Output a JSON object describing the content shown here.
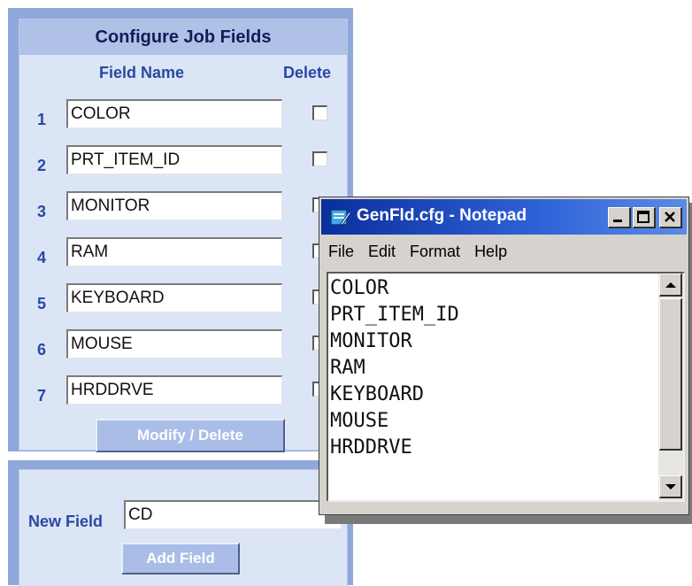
{
  "job_fields": {
    "title": "Configure Job Fields",
    "column_field_name": "Field Name",
    "column_delete": "Delete",
    "rows": [
      {
        "number": "1",
        "value": "COLOR"
      },
      {
        "number": "2",
        "value": "PRT_ITEM_ID"
      },
      {
        "number": "3",
        "value": "MONITOR"
      },
      {
        "number": "4",
        "value": "RAM"
      },
      {
        "number": "5",
        "value": "KEYBOARD"
      },
      {
        "number": "6",
        "value": "MOUSE"
      },
      {
        "number": "7",
        "value": "HRDDRVE"
      }
    ],
    "modify_button": "Modify / Delete"
  },
  "new_field": {
    "label": "New Field",
    "value": "CD",
    "add_button": "Add Field"
  },
  "notepad": {
    "title": "GenFld.cfg - Notepad",
    "icon": "notepad-icon",
    "menu": [
      "File",
      "Edit",
      "Format",
      "Help"
    ],
    "lines": [
      "COLOR",
      "PRT_ITEM_ID",
      "MONITOR",
      "RAM",
      "KEYBOARD",
      "MOUSE",
      "HRDDRVE"
    ]
  },
  "colors": {
    "panel_border": "#8fa7d9",
    "panel_bg": "#dbe5f6",
    "label_blue": "#2a48a0",
    "titlebar": "#0b2e9e"
  }
}
